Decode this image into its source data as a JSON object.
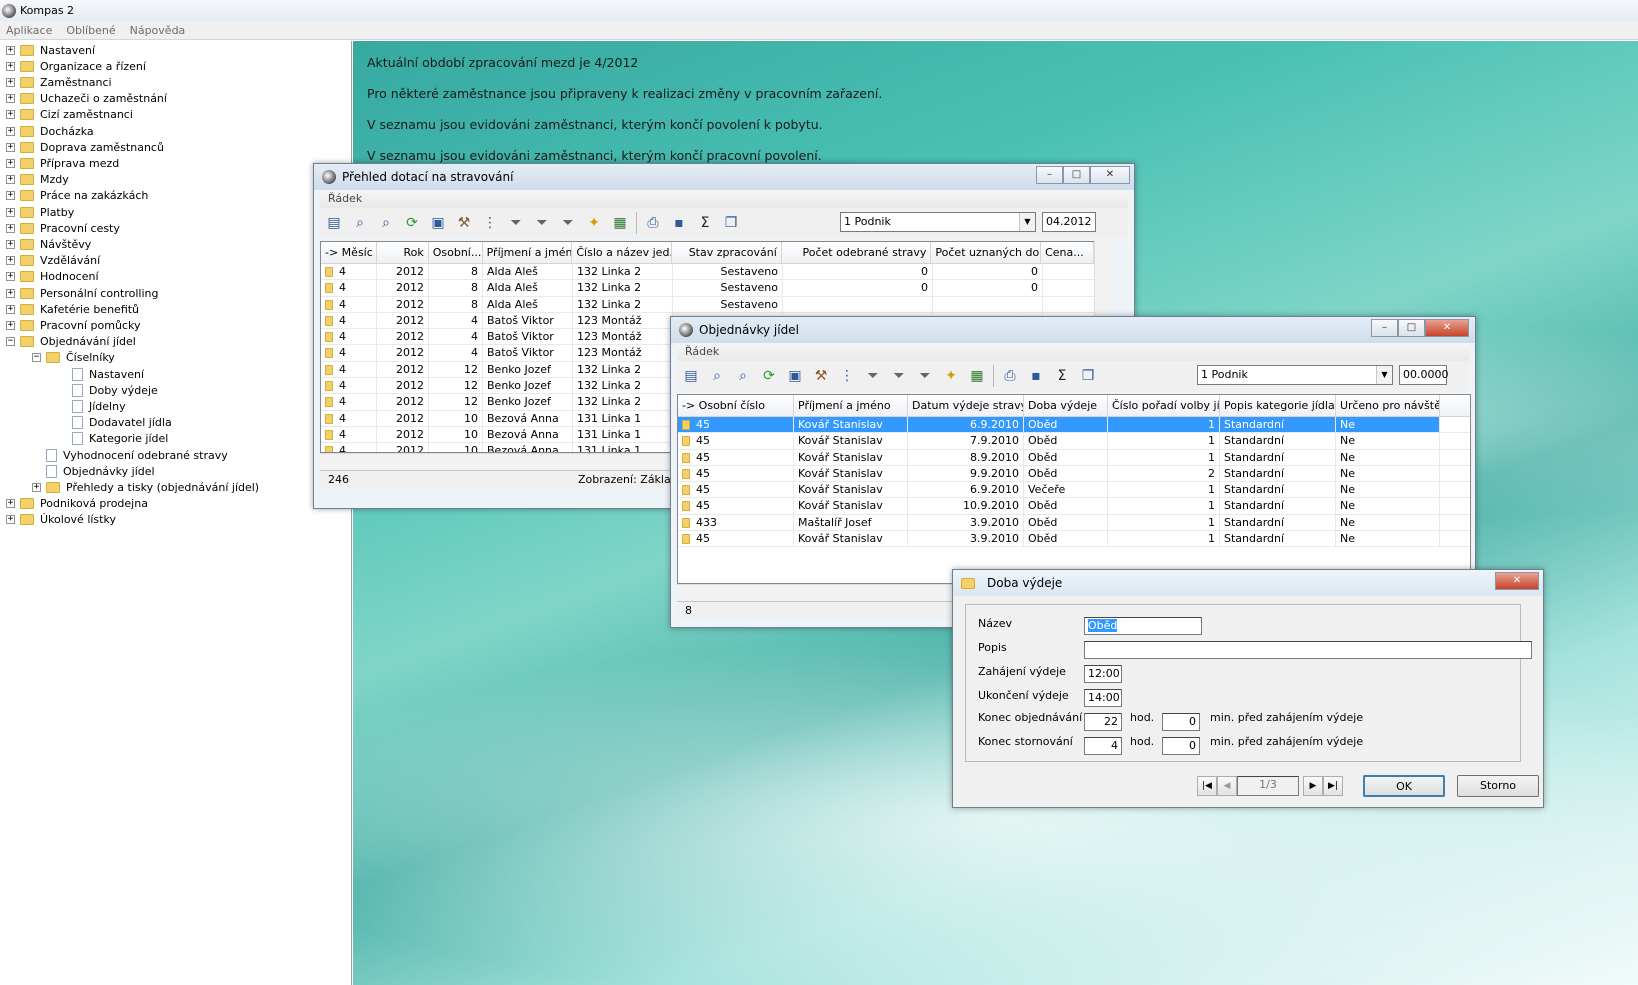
{
  "app": {
    "title": "Kompas 2"
  },
  "menu": [
    "Aplikace",
    "Oblíbené",
    "Nápověda"
  ],
  "tree": [
    {
      "label": "Nastavení",
      "level": 0,
      "type": "folder",
      "pm": "+"
    },
    {
      "label": "Organizace a řízení",
      "level": 0,
      "type": "folder",
      "pm": "+"
    },
    {
      "label": "Zaměstnanci",
      "level": 0,
      "type": "folder",
      "pm": "+"
    },
    {
      "label": "Uchazeči o zaměstnání",
      "level": 0,
      "type": "folder",
      "pm": "+"
    },
    {
      "label": "Cizí zaměstnanci",
      "level": 0,
      "type": "folder",
      "pm": "+"
    },
    {
      "label": "Docházka",
      "level": 0,
      "type": "folder",
      "pm": "+"
    },
    {
      "label": "Doprava zaměstnanců",
      "level": 0,
      "type": "folder",
      "pm": "+"
    },
    {
      "label": "Příprava mezd",
      "level": 0,
      "type": "folder",
      "pm": "+"
    },
    {
      "label": "Mzdy",
      "level": 0,
      "type": "folder",
      "pm": "+"
    },
    {
      "label": "Práce na zakázkách",
      "level": 0,
      "type": "folder",
      "pm": "+"
    },
    {
      "label": "Platby",
      "level": 0,
      "type": "folder",
      "pm": "+"
    },
    {
      "label": "Pracovní cesty",
      "level": 0,
      "type": "folder",
      "pm": "+"
    },
    {
      "label": "Návštěvy",
      "level": 0,
      "type": "folder",
      "pm": "+"
    },
    {
      "label": "Vzdělávání",
      "level": 0,
      "type": "folder",
      "pm": "+"
    },
    {
      "label": "Hodnocení",
      "level": 0,
      "type": "folder",
      "pm": "+"
    },
    {
      "label": "Personální controlling",
      "level": 0,
      "type": "folder",
      "pm": "+"
    },
    {
      "label": "Kafetérie benefitů",
      "level": 0,
      "type": "folder",
      "pm": "+"
    },
    {
      "label": "Pracovní pomůcky",
      "level": 0,
      "type": "folder",
      "pm": "+"
    },
    {
      "label": "Objednávání jídel",
      "level": 0,
      "type": "folder",
      "pm": "−"
    },
    {
      "label": "Číselníky",
      "level": 1,
      "type": "folder",
      "pm": "−"
    },
    {
      "label": "Nastavení",
      "level": 2,
      "type": "doc",
      "pm": ""
    },
    {
      "label": "Doby výdeje",
      "level": 2,
      "type": "doc",
      "pm": ""
    },
    {
      "label": "Jídelny",
      "level": 2,
      "type": "doc",
      "pm": ""
    },
    {
      "label": "Dodavatel jídla",
      "level": 2,
      "type": "doc",
      "pm": ""
    },
    {
      "label": "Kategorie jídel",
      "level": 2,
      "type": "doc",
      "pm": ""
    },
    {
      "label": "Vyhodnocení odebrané stravy",
      "level": 1,
      "type": "doc",
      "pm": ""
    },
    {
      "label": "Objednávky jídel",
      "level": 1,
      "type": "doc",
      "pm": ""
    },
    {
      "label": "Přehledy a tisky (objednávání jídel)",
      "level": 1,
      "type": "folder",
      "pm": "+"
    },
    {
      "label": "Podniková prodejna",
      "level": 0,
      "type": "folder",
      "pm": "+"
    },
    {
      "label": "Úkolové lístky",
      "level": 0,
      "type": "folder",
      "pm": "+"
    }
  ],
  "messages": [
    "Aktuální období zpracování mezd je 4/2012",
    "Pro některé zaměstnance jsou připraveny k realizaci změny v pracovním zařazení.",
    "V seznamu jsou evidováni zaměstnanci, kterým končí povolení k pobytu.",
    "V seznamu jsou evidováni zaměstnanci, kterým končí pracovní povolení."
  ],
  "win1": {
    "title": "Přehled dotací na stravování",
    "menu": "Řádek",
    "combo": "1 Podnik",
    "period": "04.2012",
    "columns": [
      "-> Měsíc",
      "Rok",
      "Osobní...",
      "Příjmení a jméno",
      "Číslo a název jed...",
      "Stav zpracování",
      "Počet odebrané stravy",
      "Počet uznaných do...",
      "Cena..."
    ],
    "rows": [
      [
        "4",
        "2012",
        "8",
        "Alda Aleš",
        "132 Linka  2",
        "Sestaveno",
        "0",
        "0"
      ],
      [
        "4",
        "2012",
        "8",
        "Alda Aleš",
        "132 Linka  2",
        "Sestaveno",
        "0",
        "0"
      ],
      [
        "4",
        "2012",
        "8",
        "Alda Aleš",
        "132 Linka  2",
        "Sestaveno",
        "",
        ""
      ],
      [
        "4",
        "2012",
        "4",
        "Batoš Viktor",
        "123 Montáž",
        "",
        "",
        ""
      ],
      [
        "4",
        "2012",
        "4",
        "Batoš Viktor",
        "123 Montáž",
        "",
        "",
        ""
      ],
      [
        "4",
        "2012",
        "4",
        "Batoš Viktor",
        "123 Montáž",
        "",
        "",
        ""
      ],
      [
        "4",
        "2012",
        "12",
        "Benko Jozef",
        "132 Linka  2",
        "",
        "",
        ""
      ],
      [
        "4",
        "2012",
        "12",
        "Benko Jozef",
        "132 Linka  2",
        "",
        "",
        ""
      ],
      [
        "4",
        "2012",
        "12",
        "Benko Jozef",
        "132 Linka  2",
        "",
        "",
        ""
      ],
      [
        "4",
        "2012",
        "10",
        "Bezová Anna",
        "131 Linka 1",
        "",
        "",
        ""
      ],
      [
        "4",
        "2012",
        "10",
        "Bezová Anna",
        "131 Linka 1",
        "",
        "",
        ""
      ],
      [
        "4",
        "2012",
        "10",
        "Bezová Anna",
        "131 Linka 1",
        "",
        "",
        ""
      ]
    ],
    "status_count": "246",
    "status_view": "Zobrazení: Základ"
  },
  "win2": {
    "title": "Objednávky jídel",
    "menu": "Řádek",
    "combo": "1 Podnik",
    "period": "00.0000",
    "columns": [
      "-> Osobní číslo",
      "Příjmení a jméno",
      "Datum výdeje stravy",
      "Doba výdeje",
      "Číslo pořadí volby jídla",
      "Popis kategorie jídla",
      "Určeno pro návštěvu"
    ],
    "rows": [
      [
        "45",
        "Kovář Stanislav",
        "6.9.2010",
        "Oběd",
        "1",
        "Standardní",
        "Ne"
      ],
      [
        "45",
        "Kovář Stanislav",
        "7.9.2010",
        "Oběd",
        "1",
        "Standardní",
        "Ne"
      ],
      [
        "45",
        "Kovář Stanislav",
        "8.9.2010",
        "Oběd",
        "1",
        "Standardní",
        "Ne"
      ],
      [
        "45",
        "Kovář Stanislav",
        "9.9.2010",
        "Oběd",
        "2",
        "Standardní",
        "Ne"
      ],
      [
        "45",
        "Kovář Stanislav",
        "6.9.2010",
        "Večeře",
        "1",
        "Standardní",
        "Ne"
      ],
      [
        "45",
        "Kovář Stanislav",
        "10.9.2010",
        "Oběd",
        "1",
        "Standardní",
        "Ne"
      ],
      [
        "433",
        "Maštalíř Josef",
        "3.9.2010",
        "Oběd",
        "1",
        "Standardní",
        "Ne"
      ],
      [
        "45",
        "Kovář Stanislav",
        "3.9.2010",
        "Oběd",
        "1",
        "Standardní",
        "Ne"
      ]
    ],
    "status_count": "8"
  },
  "dialog": {
    "title": "Doba výdeje",
    "nazev_label": "Název",
    "nazev_value": "Oběd",
    "popis_label": "Popis",
    "popis_value": "",
    "zahajeni_label": "Zahájení výdeje",
    "zahajeni_value": "12:00",
    "ukonceni_label": "Ukončení výdeje",
    "ukonceni_value": "14:00",
    "konec_obj_label": "Konec objednávání",
    "konec_obj_hod": "22",
    "konec_obj_min": "0",
    "konec_sto_label": "Konec stornování",
    "konec_sto_hod": "4",
    "konec_sto_min": "0",
    "hod": "hod.",
    "min_text": "min. před zahájením výdeje",
    "page": "1/3",
    "ok": "OK",
    "storno": "Storno"
  }
}
